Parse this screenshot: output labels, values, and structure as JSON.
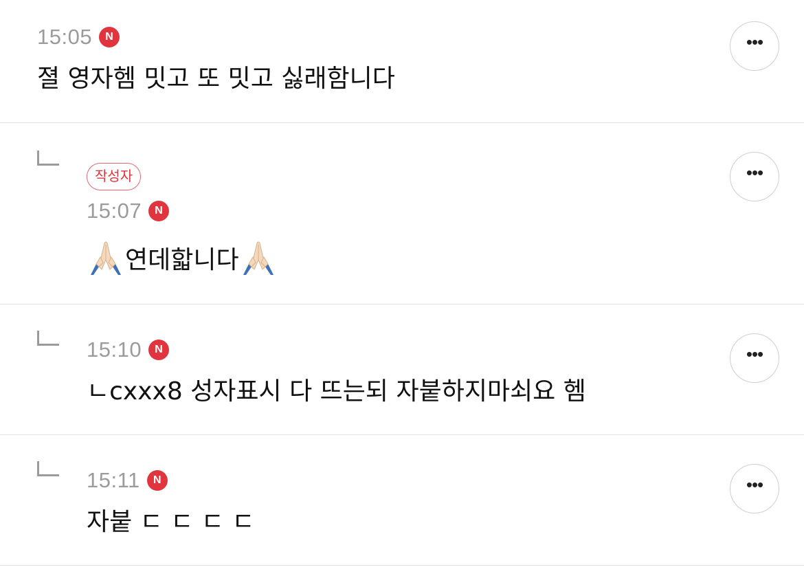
{
  "comments": [
    {
      "time": "15:05",
      "new_badge": "N",
      "text": "졀 영자헴 밋고 또 밋고 싫래함니다",
      "more": "•••"
    },
    {
      "author_badge": "작성자",
      "time": "15:07",
      "new_badge": "N",
      "text": "연데핣니다",
      "emoji": "folded-hands-icon",
      "more": "•••"
    },
    {
      "time": "15:10",
      "new_badge": "N",
      "text": "ㄴcxxx8 성자표시 다 뜨는되 자붙하지마쇠요 헴",
      "more": "•••"
    },
    {
      "time": "15:11",
      "new_badge": "N",
      "text": "자붙 ㄷ ㄷ ㄷ ㄷ",
      "more": "•••"
    }
  ],
  "colors": {
    "accent": "#e0353f",
    "muted": "#9b9b9b",
    "divider": "#e2e2e2"
  }
}
